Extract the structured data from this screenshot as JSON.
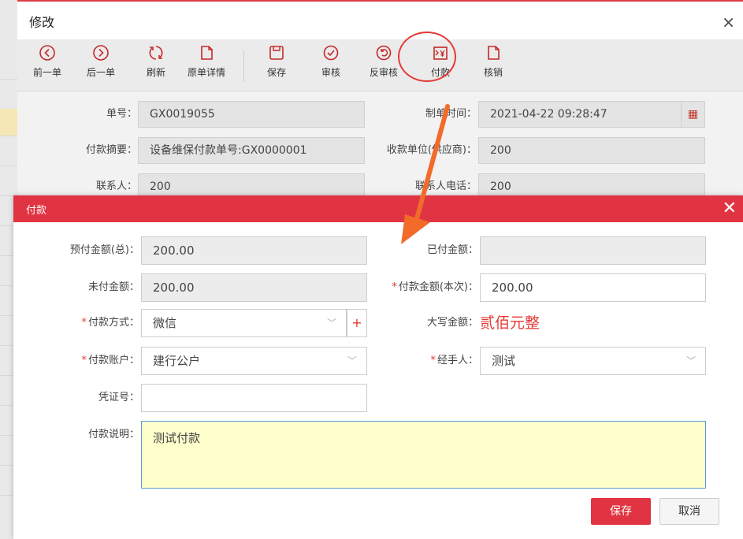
{
  "outer": {
    "title": "修改",
    "close": "×",
    "toolbar": [
      {
        "id": "prev",
        "label": "前一单",
        "icon": "chevron-left-circle-icon"
      },
      {
        "id": "next",
        "label": "后一单",
        "icon": "chevron-right-circle-icon"
      },
      {
        "id": "refresh",
        "label": "刷新",
        "icon": "refresh-icon"
      },
      {
        "id": "origin",
        "label": "原单详情",
        "icon": "document-icon"
      },
      {
        "id": "save",
        "label": "保存",
        "icon": "save-icon"
      },
      {
        "id": "audit",
        "label": "审核",
        "icon": "check-circle-icon"
      },
      {
        "id": "unaudit",
        "label": "反审核",
        "icon": "undo-circle-icon"
      },
      {
        "id": "pay",
        "label": "付款",
        "icon": "yen-payment-icon"
      },
      {
        "id": "writeoff",
        "label": "核销",
        "icon": "document-icon"
      }
    ],
    "form": {
      "order_no_label": "单号：",
      "order_no": "GX0019055",
      "create_time_label": "制单时间：",
      "create_time": "2021-04-22 09:28:47",
      "summary_label": "付款摘要：",
      "summary": "设备维保付款单号:GX0000001",
      "payee_label": "收款单位(供应商)：",
      "payee": "200",
      "contact_label": "联系人：",
      "contact": "200",
      "phone_label": "联系人电话：",
      "phone": "200"
    }
  },
  "payment": {
    "title": "付款",
    "close": "✕",
    "prepaid_label": "预付金额(总)：",
    "prepaid": "200.00",
    "paid_label": "已付金额：",
    "paid": "",
    "unpaid_label": "未付金额：",
    "unpaid": "200.00",
    "pay_amount_label": "付款金额(本次)：",
    "pay_amount": "200.00",
    "method_label": "付款方式：",
    "method": "微信",
    "uppercase_label": "大写金额：",
    "uppercase": "贰佰元整",
    "account_label": "付款账户：",
    "account": "建行公户",
    "handler_label": "经手人：",
    "handler": "测试",
    "voucher_label": "凭证号：",
    "voucher": "",
    "remark_label": "付款说明：",
    "remark": "测试付款",
    "save_label": "保存",
    "cancel_label": "取消",
    "required_mark": "*"
  },
  "colors": {
    "accent": "#e13442",
    "required": "#e53935",
    "remark_bg": "#ffffcc"
  }
}
